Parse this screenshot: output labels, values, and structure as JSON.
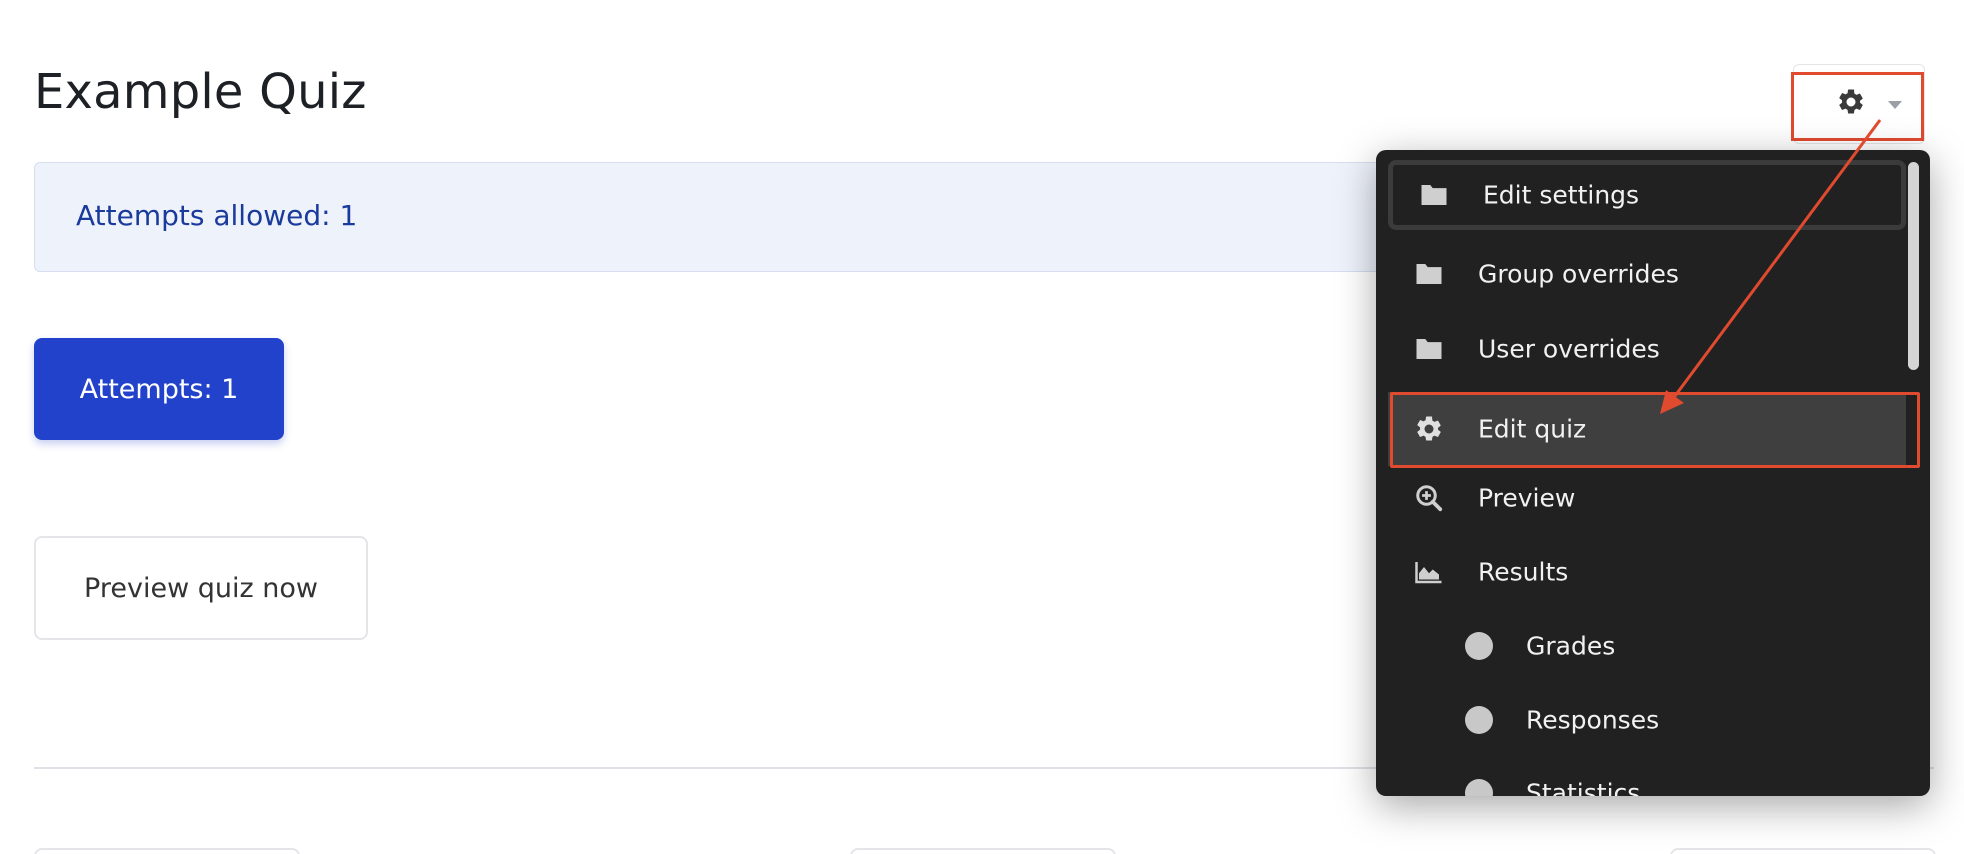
{
  "page": {
    "title": "Example Quiz"
  },
  "info": {
    "attempts_allowed": "Attempts allowed: 1"
  },
  "buttons": {
    "attempts": "Attempts: 1",
    "preview": "Preview quiz now"
  },
  "settings_menu": {
    "toggle_icon": "gear-icon",
    "caret_icon": "chevron-down-icon",
    "items": [
      {
        "label": "Edit settings",
        "icon": "folder-icon"
      },
      {
        "label": "Group overrides",
        "icon": "folder-icon"
      },
      {
        "label": "User overrides",
        "icon": "folder-icon"
      },
      {
        "label": "Edit quiz",
        "icon": "gear-icon"
      },
      {
        "label": "Preview",
        "icon": "zoom-in-icon"
      },
      {
        "label": "Results",
        "icon": "area-chart-icon"
      },
      {
        "label": "Grades",
        "icon": "circle-icon"
      },
      {
        "label": "Responses",
        "icon": "circle-icon"
      },
      {
        "label": "Statistics",
        "icon": "circle-icon"
      }
    ]
  },
  "colors": {
    "accent": "#2242cc",
    "annotation": "#e04a2f",
    "menu_bg": "#212121",
    "info_bg": "#eef2fb",
    "info_text": "#1a3a9c"
  }
}
